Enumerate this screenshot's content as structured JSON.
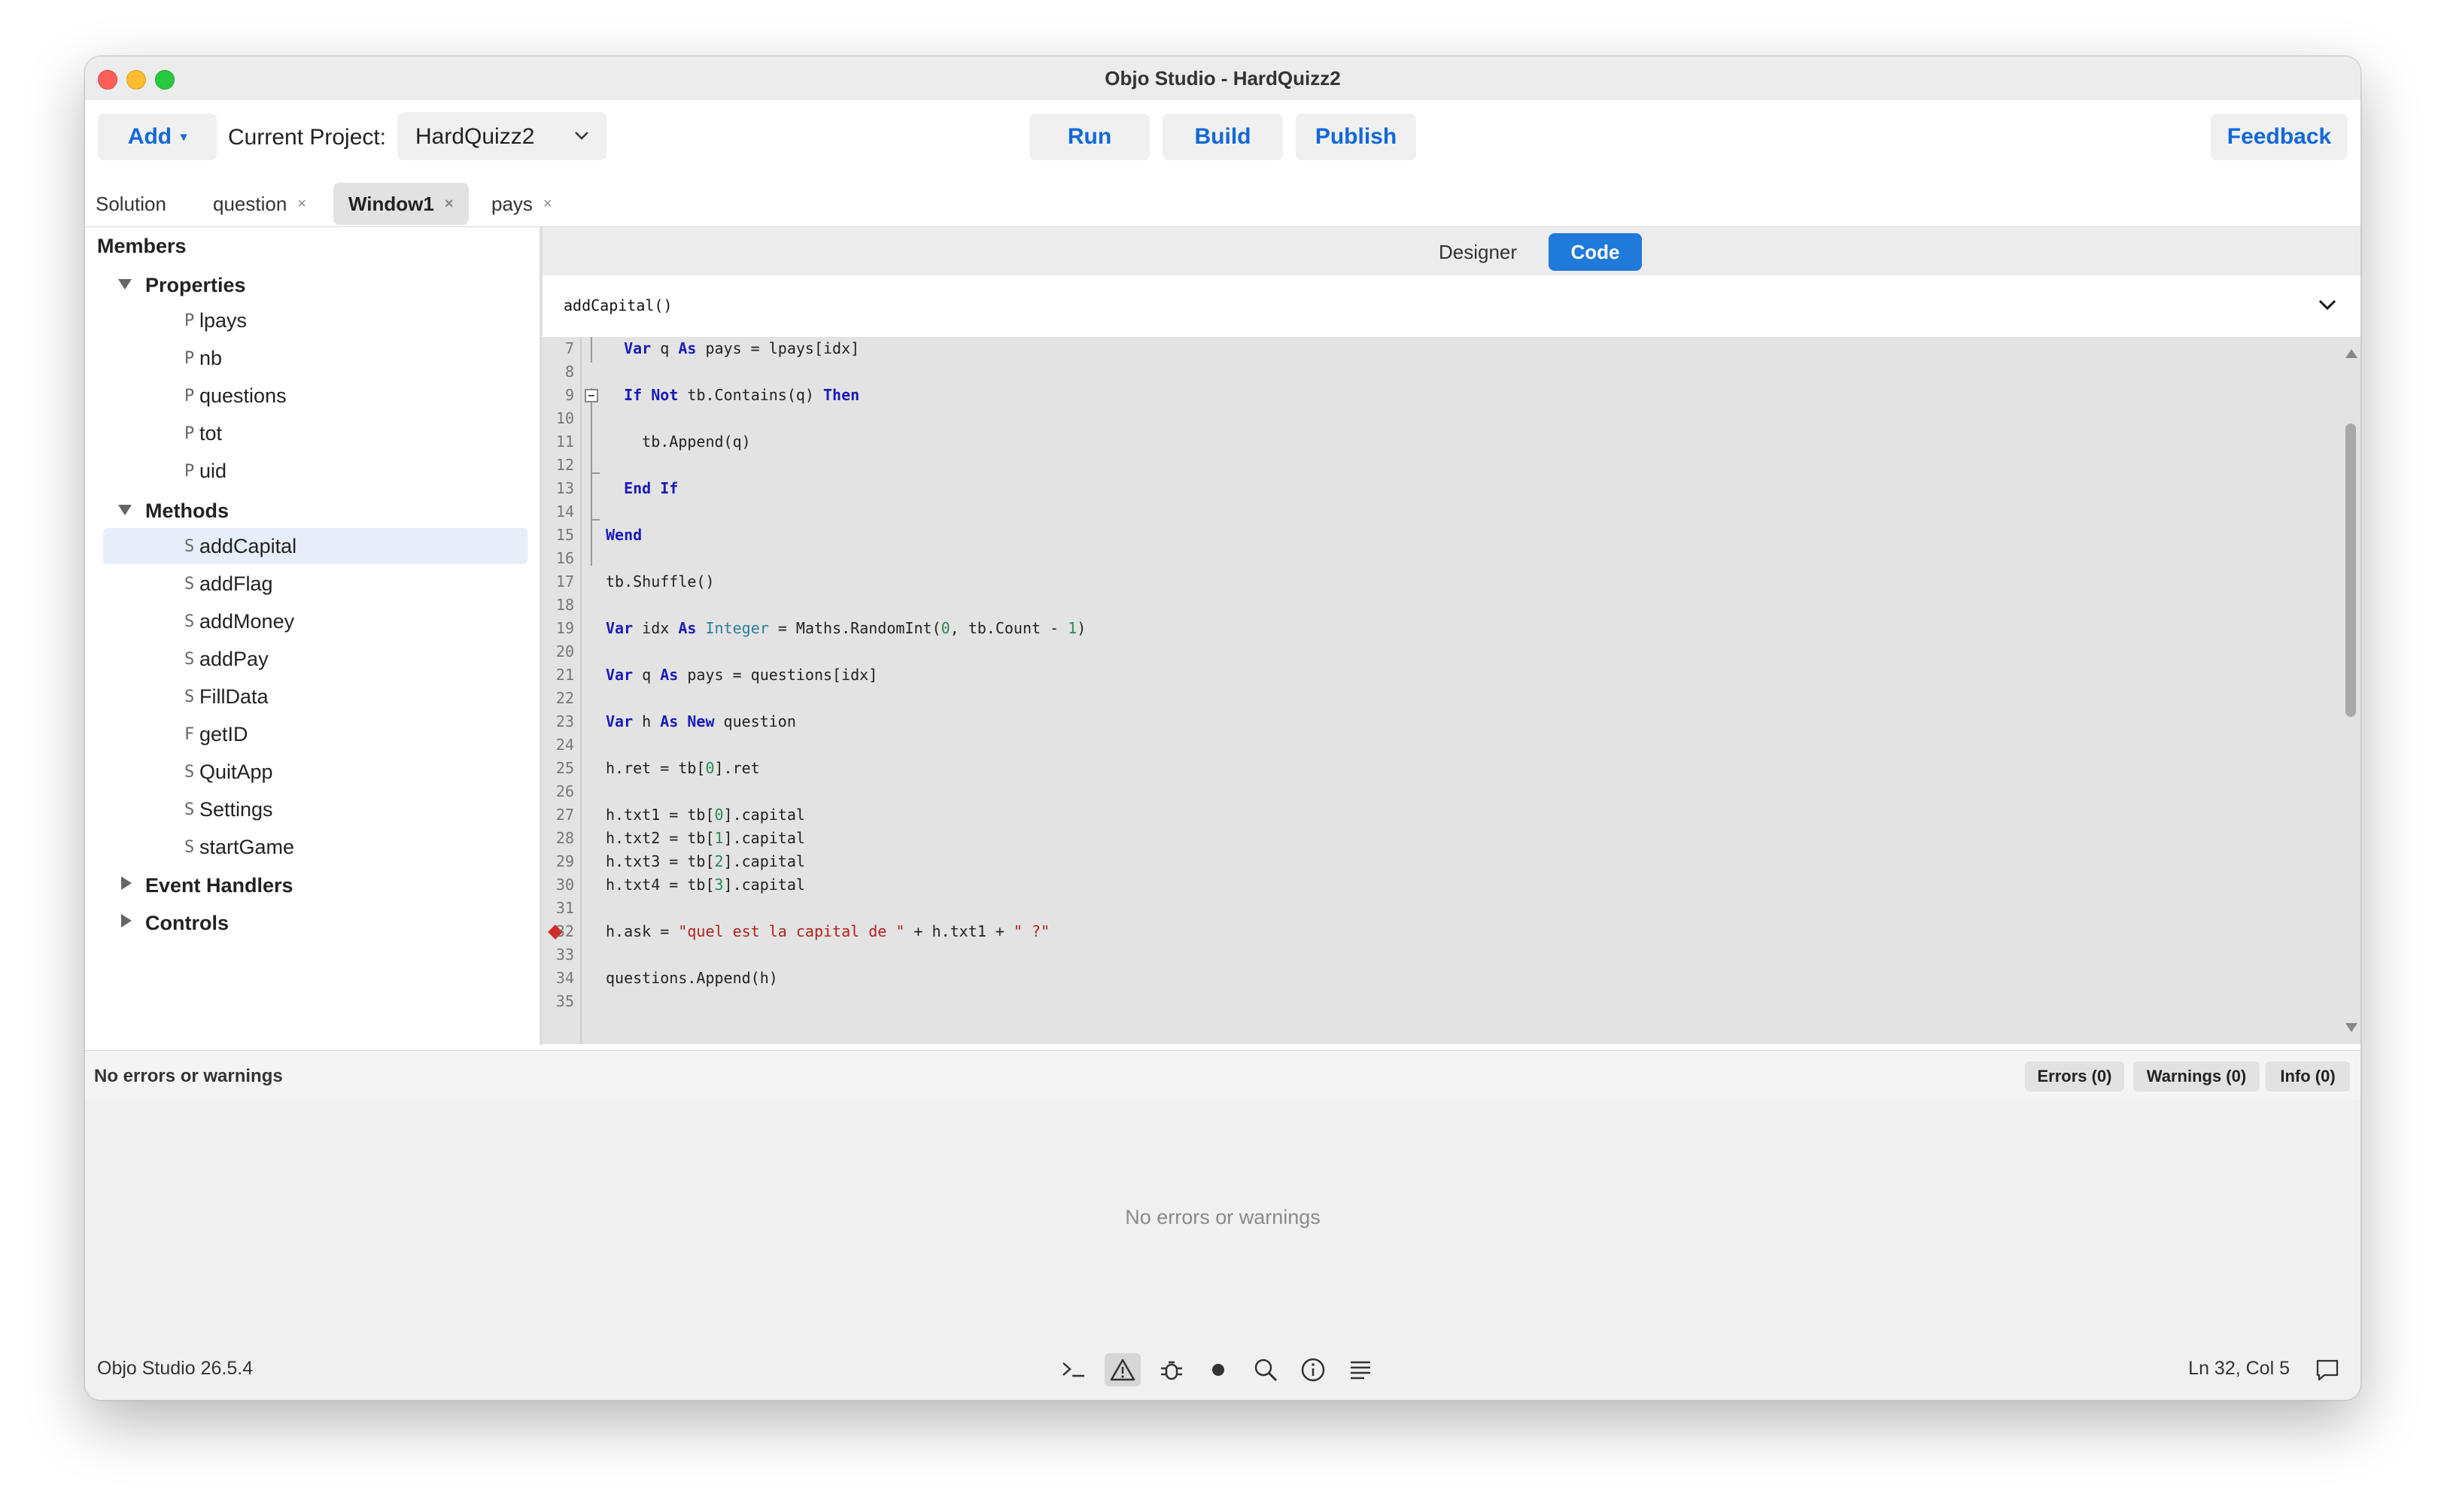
{
  "window": {
    "title": "Objo Studio - HardQuizz2"
  },
  "toolbar": {
    "add_label": "Add",
    "add_caret": "▾",
    "current_project_label": "Current Project:",
    "project_value": "HardQuizz2",
    "run_label": "Run",
    "build_label": "Build",
    "publish_label": "Publish",
    "feedback_label": "Feedback"
  },
  "tabs": [
    {
      "label": "Solution",
      "closable": false,
      "active": false
    },
    {
      "label": "question",
      "closable": true,
      "active": false
    },
    {
      "label": "Window1",
      "closable": true,
      "active": true
    },
    {
      "label": "pays",
      "closable": true,
      "active": false
    }
  ],
  "tab_close_glyph": "×",
  "sidebar": {
    "title": "Members",
    "groups": [
      {
        "label": "Properties",
        "expanded": true,
        "items": [
          {
            "kind": "P",
            "name": "lpays"
          },
          {
            "kind": "P",
            "name": "nb"
          },
          {
            "kind": "P",
            "name": "questions"
          },
          {
            "kind": "P",
            "name": "tot"
          },
          {
            "kind": "P",
            "name": "uid"
          }
        ]
      },
      {
        "label": "Methods",
        "expanded": true,
        "items": [
          {
            "kind": "S",
            "name": "addCapital",
            "selected": true
          },
          {
            "kind": "S",
            "name": "addFlag"
          },
          {
            "kind": "S",
            "name": "addMoney"
          },
          {
            "kind": "S",
            "name": "addPay"
          },
          {
            "kind": "S",
            "name": "FillData"
          },
          {
            "kind": "F",
            "name": "getID"
          },
          {
            "kind": "S",
            "name": "QuitApp"
          },
          {
            "kind": "S",
            "name": "Settings"
          },
          {
            "kind": "S",
            "name": "startGame"
          }
        ]
      },
      {
        "label": "Event Handlers",
        "expanded": false,
        "items": []
      },
      {
        "label": "Controls",
        "expanded": false,
        "items": []
      }
    ]
  },
  "editor": {
    "mode_designer": "Designer",
    "mode_code": "Code",
    "active_mode": "Code",
    "method_name": "addCapital()",
    "breakpoint_line": 32,
    "lines": [
      {
        "n": "7",
        "code": "  Var q As pays = lpays[idx]"
      },
      {
        "n": "8",
        "code": ""
      },
      {
        "n": "9",
        "code": "  If Not tb.Contains(q) Then"
      },
      {
        "n": "10",
        "code": ""
      },
      {
        "n": "11",
        "code": "    tb.Append(q)"
      },
      {
        "n": "12",
        "code": ""
      },
      {
        "n": "13",
        "code": "  End If"
      },
      {
        "n": "14",
        "code": ""
      },
      {
        "n": "15",
        "code": "Wend"
      },
      {
        "n": "16",
        "code": ""
      },
      {
        "n": "17",
        "code": "tb.Shuffle()"
      },
      {
        "n": "18",
        "code": ""
      },
      {
        "n": "19",
        "code": "Var idx As Integer = Maths.RandomInt(0, tb.Count - 1)"
      },
      {
        "n": "20",
        "code": ""
      },
      {
        "n": "21",
        "code": "Var q As pays = questions[idx]"
      },
      {
        "n": "22",
        "code": ""
      },
      {
        "n": "23",
        "code": "Var h As New question"
      },
      {
        "n": "24",
        "code": ""
      },
      {
        "n": "25",
        "code": "h.ret = tb[0].ret"
      },
      {
        "n": "26",
        "code": ""
      },
      {
        "n": "27",
        "code": "h.txt1 = tb[0].capital"
      },
      {
        "n": "28",
        "code": "h.txt2 = tb[1].capital"
      },
      {
        "n": "29",
        "code": "h.txt3 = tb[2].capital"
      },
      {
        "n": "30",
        "code": "h.txt4 = tb[3].capital"
      },
      {
        "n": "31",
        "code": ""
      },
      {
        "n": "32",
        "code": "h.ask = \"quel est la capital de \" + h.txt1 + \" ?\""
      },
      {
        "n": "33",
        "code": ""
      },
      {
        "n": "34",
        "code": "questions.Append(h)"
      },
      {
        "n": "35",
        "code": ""
      }
    ]
  },
  "problems": {
    "summary": "No errors or warnings",
    "errors_label": "Errors (0)",
    "warnings_label": "Warnings (0)",
    "info_label": "Info (0)",
    "empty_message": "No errors or warnings"
  },
  "statusbar": {
    "version": "Objo Studio 26.5.4",
    "position": "Ln 32, Col 5",
    "icons": [
      "terminal-icon",
      "warning-icon",
      "bug-icon",
      "record-icon",
      "search-icon",
      "info-icon",
      "list-icon"
    ],
    "active_icon": "warning-icon"
  },
  "colors": {
    "accent": "#1f7ad9",
    "button_text": "#1268d8",
    "keyword": "#1a1ab8",
    "type": "#2a7f9e",
    "number": "#2a8a56",
    "string": "#b22222",
    "breakpoint": "#d42a2a"
  }
}
